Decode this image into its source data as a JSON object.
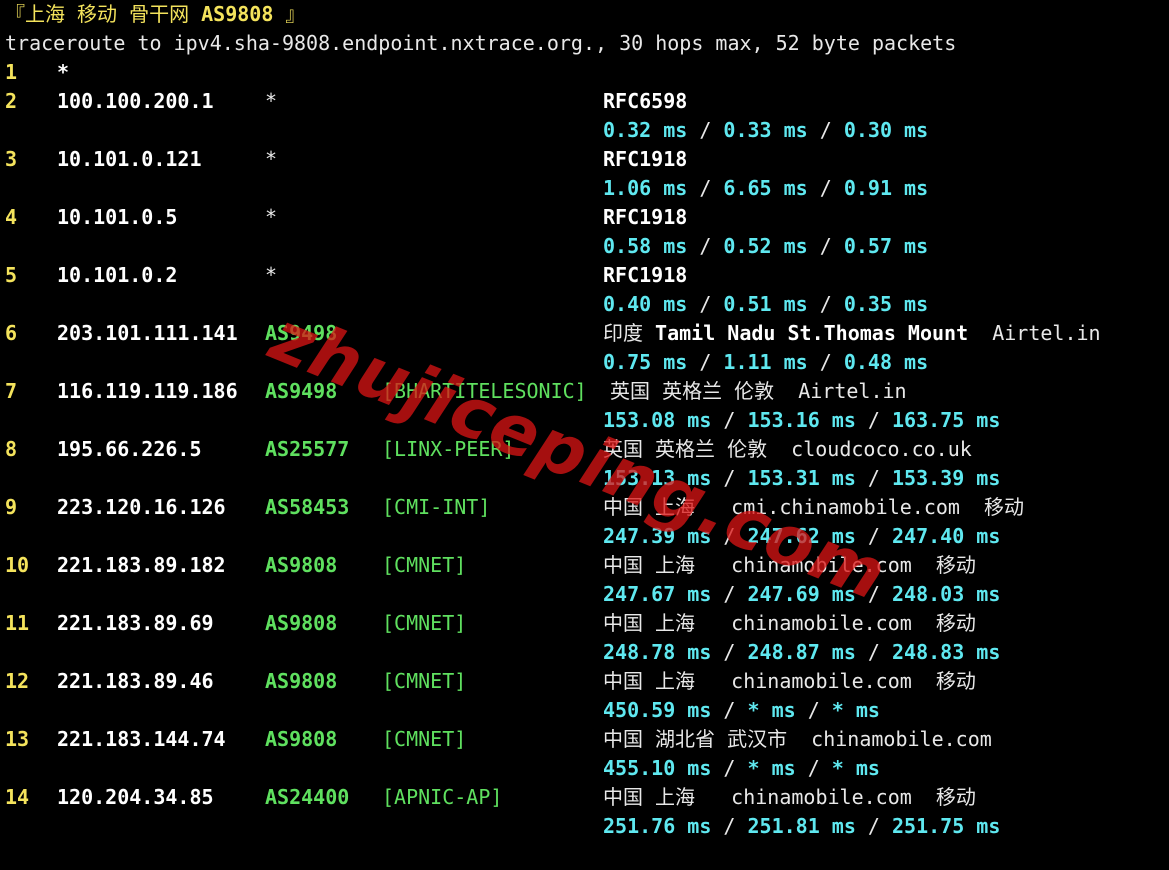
{
  "header": {
    "title_prefix": "『上海 移动 骨干网 ",
    "title_as": "AS9808",
    "title_suffix": " 』",
    "command": "traceroute to ipv4.sha-9808.endpoint.nxtrace.org., 30 hops max, 52 byte packets"
  },
  "hops": [
    {
      "num": "1",
      "ip": "*",
      "as": "",
      "tag": "",
      "geo": "",
      "rtt": null
    },
    {
      "num": "2",
      "ip": "100.100.200.1",
      "as": "*",
      "tag": "",
      "geo": "RFC6598",
      "geo_bold": true,
      "rtt": [
        "0.32 ms",
        "0.33 ms",
        "0.30 ms"
      ]
    },
    {
      "num": "3",
      "ip": "10.101.0.121",
      "as": "*",
      "tag": "",
      "geo": "RFC1918",
      "geo_bold": true,
      "rtt": [
        "1.06 ms",
        "6.65 ms",
        "0.91 ms"
      ]
    },
    {
      "num": "4",
      "ip": "10.101.0.5",
      "as": "*",
      "tag": "",
      "geo": "RFC1918",
      "geo_bold": true,
      "rtt": [
        "0.58 ms",
        "0.52 ms",
        "0.57 ms"
      ]
    },
    {
      "num": "5",
      "ip": "10.101.0.2",
      "as": "*",
      "tag": "",
      "geo": "RFC1918",
      "geo_bold": true,
      "rtt": [
        "0.40 ms",
        "0.51 ms",
        "0.35 ms"
      ]
    },
    {
      "num": "6",
      "ip": "203.101.111.141",
      "as": "AS9498",
      "tag": "",
      "geo": "印度 ",
      "geo_b": "Tamil Nadu St.Thomas Mount",
      "geo_tail": "  Airtel.in",
      "rtt": [
        "0.75 ms",
        "1.11 ms",
        "0.48 ms"
      ]
    },
    {
      "num": "7",
      "ip": "116.119.119.186",
      "as": "AS9498",
      "tag": "[BHARTITELESONIC]",
      "geo": " 英国 英格兰 伦敦  Airtel.in",
      "geo_shift": true,
      "rtt": [
        "153.08 ms",
        "153.16 ms",
        "163.75 ms"
      ]
    },
    {
      "num": "8",
      "ip": "195.66.226.5",
      "as": "AS25577",
      "tag": "[LINX-PEER]",
      "geo": "英国 英格兰 伦敦  cloudcoco.co.uk",
      "rtt": [
        "153.13 ms",
        "153.31 ms",
        "153.39 ms"
      ]
    },
    {
      "num": "9",
      "ip": "223.120.16.126",
      "as": "AS58453",
      "tag": "[CMI-INT]",
      "geo": "中国 上海   cmi.chinamobile.com  移动",
      "rtt": [
        "247.39 ms",
        "247.62 ms",
        "247.40 ms"
      ]
    },
    {
      "num": "10",
      "ip": "221.183.89.182",
      "as": "AS9808",
      "tag": "[CMNET]",
      "geo": "中国 上海   chinamobile.com  移动",
      "rtt": [
        "247.67 ms",
        "247.69 ms",
        "248.03 ms"
      ]
    },
    {
      "num": "11",
      "ip": "221.183.89.69",
      "as": "AS9808",
      "tag": "[CMNET]",
      "geo": "中国 上海   chinamobile.com  移动",
      "rtt": [
        "248.78 ms",
        "248.87 ms",
        "248.83 ms"
      ]
    },
    {
      "num": "12",
      "ip": "221.183.89.46",
      "as": "AS9808",
      "tag": "[CMNET]",
      "geo": "中国 上海   chinamobile.com  移动",
      "rtt": [
        "450.59 ms",
        "* ms",
        "* ms"
      ]
    },
    {
      "num": "13",
      "ip": "221.183.144.74",
      "as": "AS9808",
      "tag": "[CMNET]",
      "geo": "中国 湖北省 武汉市  chinamobile.com",
      "rtt": [
        "455.10 ms",
        "* ms",
        "* ms"
      ]
    },
    {
      "num": "14",
      "ip": "120.204.34.85",
      "as": "AS24400",
      "tag": "[APNIC-AP]",
      "geo": "中国 上海   chinamobile.com  移动",
      "rtt": [
        "251.76 ms",
        "251.81 ms",
        "251.75 ms"
      ]
    }
  ],
  "rtt_separator": " / ",
  "watermark": "zhujiceping.com",
  "colors": {
    "background": "#000000",
    "hop_number": "#f4e35c",
    "asn": "#5fe05f",
    "rtt": "#5fe8f0",
    "text": "#e8e8e8"
  }
}
